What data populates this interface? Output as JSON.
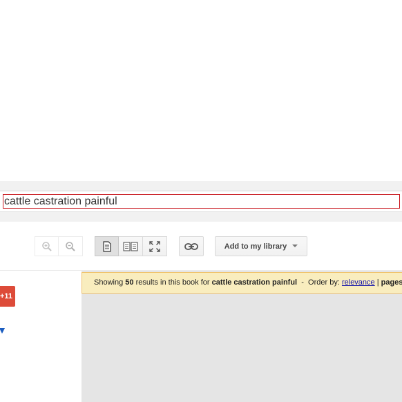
{
  "search": {
    "query": "cattle castration painful"
  },
  "toolbar": {
    "zoom_in_icon": "zoom-in-icon",
    "zoom_out_icon": "zoom-out-icon",
    "single_page_icon": "single-page-view-icon",
    "two_page_icon": "two-page-view-icon",
    "fullscreen_icon": "fullscreen-icon",
    "link_icon": "link-icon",
    "library_label": "Add to my library"
  },
  "sidebar": {
    "badge_text": "+11",
    "badge_color": "#dd4b39",
    "arrow_color": "#1a5cc0"
  },
  "results": {
    "prefix": "Showing",
    "count": "50",
    "middle": "results in this book for",
    "query": "cattle castration painful",
    "separator": "-",
    "order_label": "Order by:",
    "order_relevance": "relevance",
    "order_divider": "|",
    "order_pages": "pages",
    "banner_bg": "#f9edbe"
  }
}
